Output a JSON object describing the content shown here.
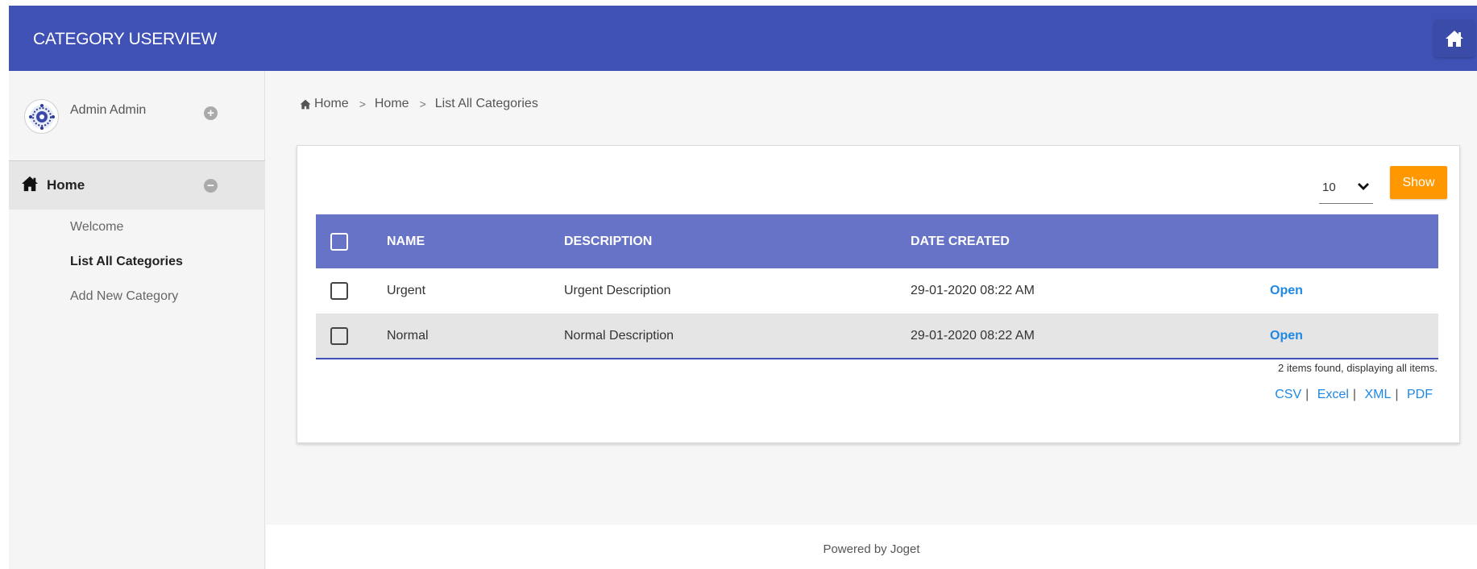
{
  "header": {
    "title": "CATEGORY USERVIEW",
    "home_icon": "home-icon",
    "color": "#3f51b5"
  },
  "sidebar": {
    "profile": {
      "name": "Admin Admin",
      "expand_icon": "plus-circle-icon"
    },
    "menu": {
      "label": "Home",
      "icon": "home-icon",
      "collapse_icon": "minus-circle-icon",
      "items": [
        {
          "label": "Welcome",
          "active": false
        },
        {
          "label": "List All Categories",
          "active": true
        },
        {
          "label": "Add New Category",
          "active": false
        }
      ]
    }
  },
  "breadcrumb": {
    "items": [
      "Home",
      "Home",
      "List All Categories"
    ],
    "separator": ">"
  },
  "list": {
    "page_size": "10",
    "show_label": "Show",
    "columns": [
      "NAME",
      "DESCRIPTION",
      "DATE CREATED"
    ],
    "rows": [
      {
        "name": "Urgent",
        "description": "Urgent Description",
        "date_created": "29-01-2020 08:22 AM",
        "action": "Open"
      },
      {
        "name": "Normal",
        "description": "Normal Description",
        "date_created": "29-01-2020 08:22 AM",
        "action": "Open"
      }
    ],
    "summary": "2 items found, displaying all items.",
    "exports": [
      "CSV",
      "Excel",
      "XML",
      "PDF"
    ]
  },
  "footer": {
    "text": "Powered by Joget"
  },
  "colors": {
    "accent": "#3f51b5",
    "table_header": "#6773c6",
    "button": "#ff9800",
    "link": "#1e88e5"
  }
}
